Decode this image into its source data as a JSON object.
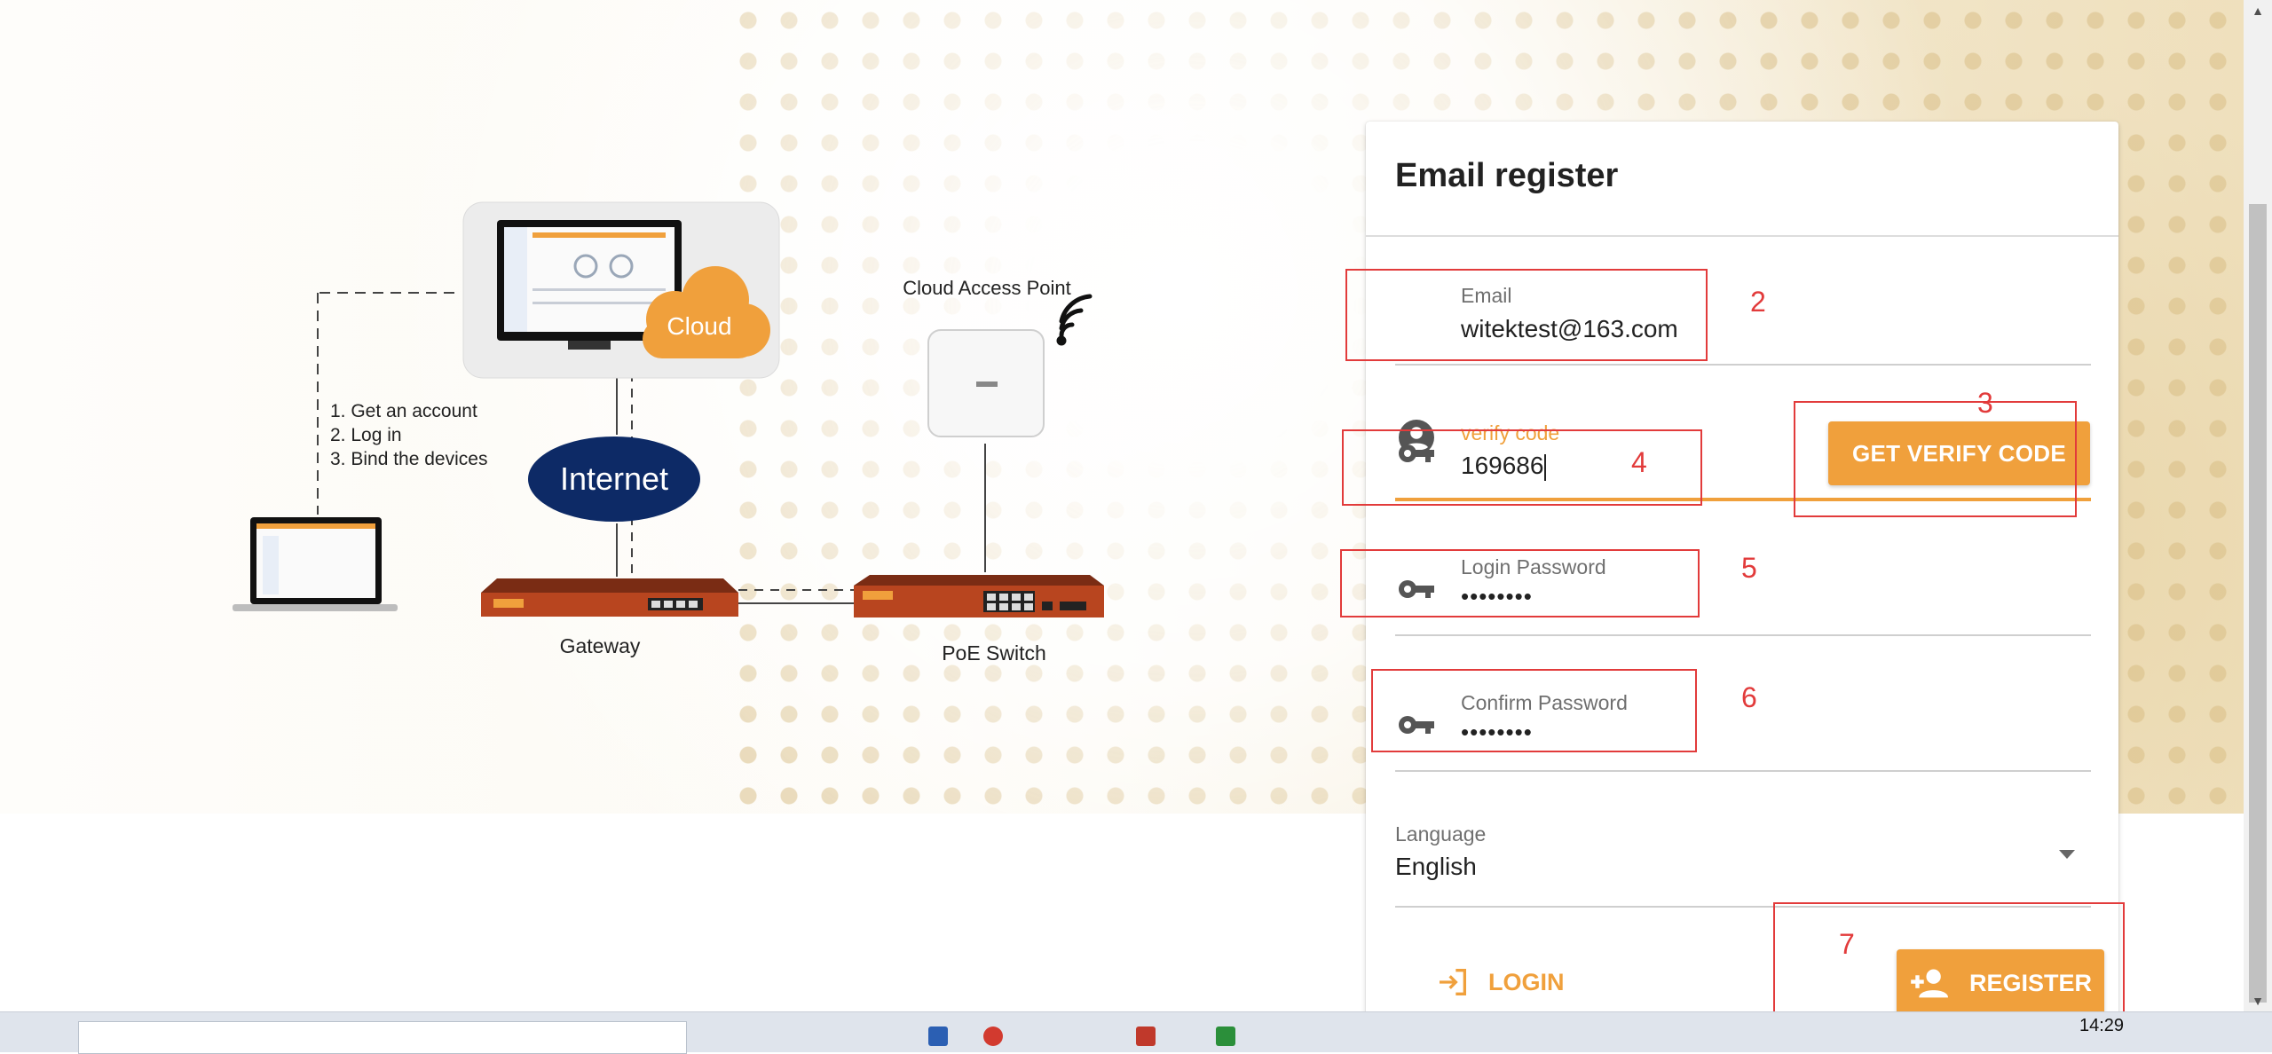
{
  "diagram": {
    "cloud_label": "Cloud",
    "internet_label": "Internet",
    "access_point_label": "Cloud Access Point",
    "gateway_label": "Gateway",
    "switch_label": "PoE Switch",
    "steps": [
      "1. Get an account",
      "2. Log in",
      "3. Bind the devices"
    ]
  },
  "form": {
    "title": "Email register",
    "email": {
      "label": "Email",
      "value": "witektest@163.com"
    },
    "verify": {
      "label": "verify code",
      "value": "169686",
      "button": "GET VERIFY CODE"
    },
    "password": {
      "label": "Login Password",
      "value": "••••••••"
    },
    "confirm": {
      "label": "Confirm Password",
      "value": "••••••••"
    },
    "language": {
      "label": "Language",
      "value": "English"
    },
    "login_button": "LOGIN",
    "register_button": "REGISTER"
  },
  "annotations": [
    "2",
    "3",
    "4",
    "5",
    "6",
    "7"
  ],
  "taskbar": {
    "time": "14:29"
  },
  "colors": {
    "accent": "#f0a03c",
    "annotation": "#e23b3b",
    "internet": "#0d2a66"
  }
}
